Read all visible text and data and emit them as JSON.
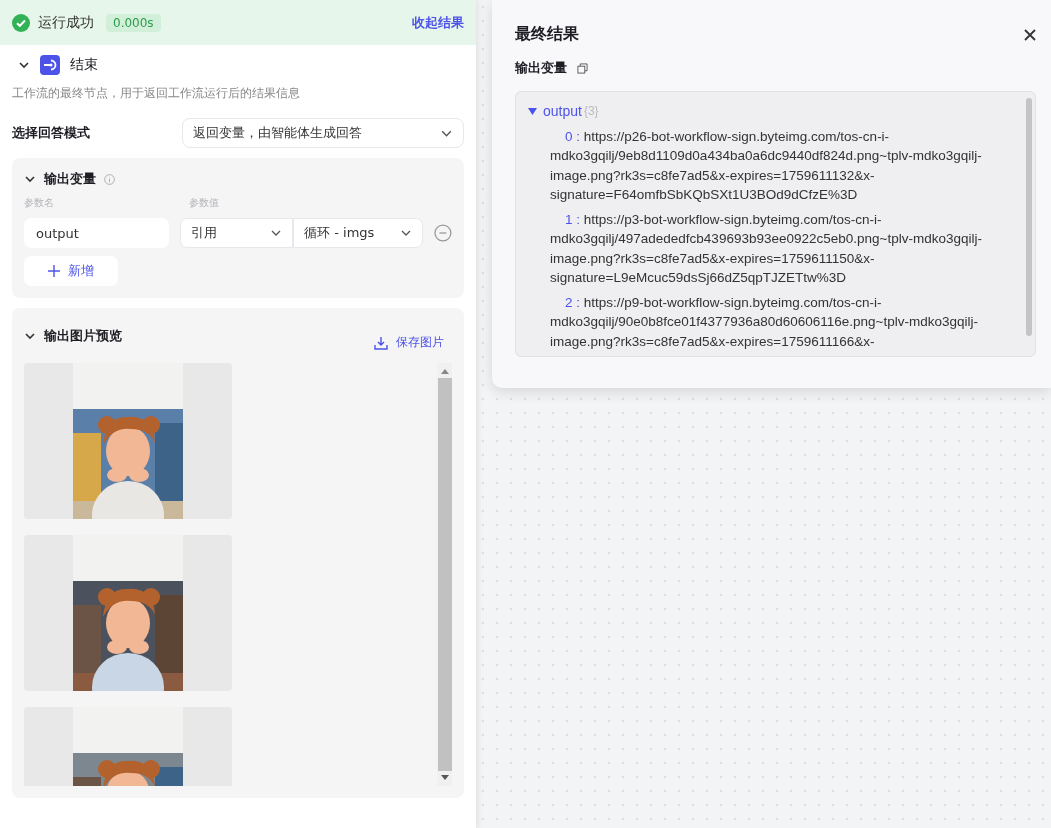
{
  "run_status": {
    "success": true,
    "label": "运行成功",
    "duration": "0.000s",
    "collapse_link": "收起结果"
  },
  "node": {
    "title": "结束",
    "expanded": true,
    "description": "工作流的最终节点，用于返回工作流运行后的结果信息"
  },
  "answer_mode": {
    "label": "选择回答模式",
    "value": "返回变量，由智能体生成回答"
  },
  "output_vars": {
    "title": "输出变量",
    "expanded": true,
    "col_name": "参数名",
    "col_value": "参数值",
    "rows": [
      {
        "name": "output",
        "source": "引用",
        "value": "循环 - imgs"
      }
    ],
    "add_button": "新增"
  },
  "image_preview": {
    "title": "输出图片预览",
    "expanded": true,
    "save_button": "保存图片"
  },
  "result_panel": {
    "title": "最终结果",
    "section": "输出变量",
    "root": "output",
    "count": "{3}",
    "expanded": true,
    "items": [
      {
        "index": "0 :",
        "value": "https://p26-bot-workflow-sign.byteimg.com/tos-cn-i-mdko3gqilj/9eb8d1109d0a434ba0a6dc9440df824d.png~tplv-mdko3gqilj-image.png?rk3s=c8fe7ad5&x-expires=1759611132&x-signature=F64omfbSbKQbSXt1U3BOd9dCfzE%3D"
      },
      {
        "index": "1 :",
        "value": "https://p3-bot-workflow-sign.byteimg.com/tos-cn-i-mdko3gqilj/497adededfcb439693b93ee0922c5eb0.png~tplv-mdko3gqilj-image.png?rk3s=c8fe7ad5&x-expires=1759611150&x-signature=L9eMcuc59dsSj66dZ5qpTJZETtw%3D"
      },
      {
        "index": "2 :",
        "value": "https://p9-bot-workflow-sign.byteimg.com/tos-cn-i-mdko3gqilj/90e0b8fce01f4377936a80d60606116e.png~tplv-mdko3gqilj-image.png?rk3s=c8fe7ad5&x-expires=1759611166&x-"
      }
    ]
  }
}
